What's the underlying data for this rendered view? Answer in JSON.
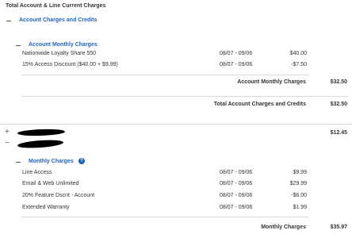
{
  "header": {
    "title": "Total Account & Line Current Charges"
  },
  "account": {
    "section_title": "Account Charges and Credits",
    "monthly_title": "Account Monthly Charges",
    "items": [
      {
        "name": "Nationwide Loyalty Share 550",
        "period": "08/07 - 09/06",
        "amount": "$40.00"
      },
      {
        "name": "15% Access Discount ($40.00 + $9.99)",
        "period": "08/07 - 09/06",
        "amount": "-$7.50"
      }
    ],
    "subtotal_label": "Account Monthly Charges",
    "subtotal_value": "$32.50",
    "total_label": "Total Account Charges and Credits",
    "total_value": "$32.50"
  },
  "line1": {
    "toggle": "+",
    "total": "$12.45"
  },
  "line2": {
    "toggle": "−",
    "monthly_title": "Monthly Charges",
    "help_glyph": "?",
    "items": [
      {
        "name": "Line Access",
        "period": "08/07 - 09/06",
        "amount": "$9.99"
      },
      {
        "name": "Email & Web Unlimited",
        "period": "08/07 - 09/06",
        "amount": "$29.99"
      },
      {
        "name": "20% Feature Dscnt - Account",
        "period": "08/07 - 09/06",
        "amount": "-$6.00"
      },
      {
        "name": "Extended Warranty",
        "period": "08/07 - 09/06",
        "amount": "$1.99"
      }
    ],
    "subtotal_label": "Monthly Charges",
    "subtotal_value": "$35.97"
  },
  "colors": {
    "accent": "#1f64b8",
    "divider": "#d9d9d9",
    "text": "#333333"
  },
  "icons": {
    "collapse": "minus-icon",
    "expand": "plus-icon",
    "help": "question-circle-icon"
  }
}
